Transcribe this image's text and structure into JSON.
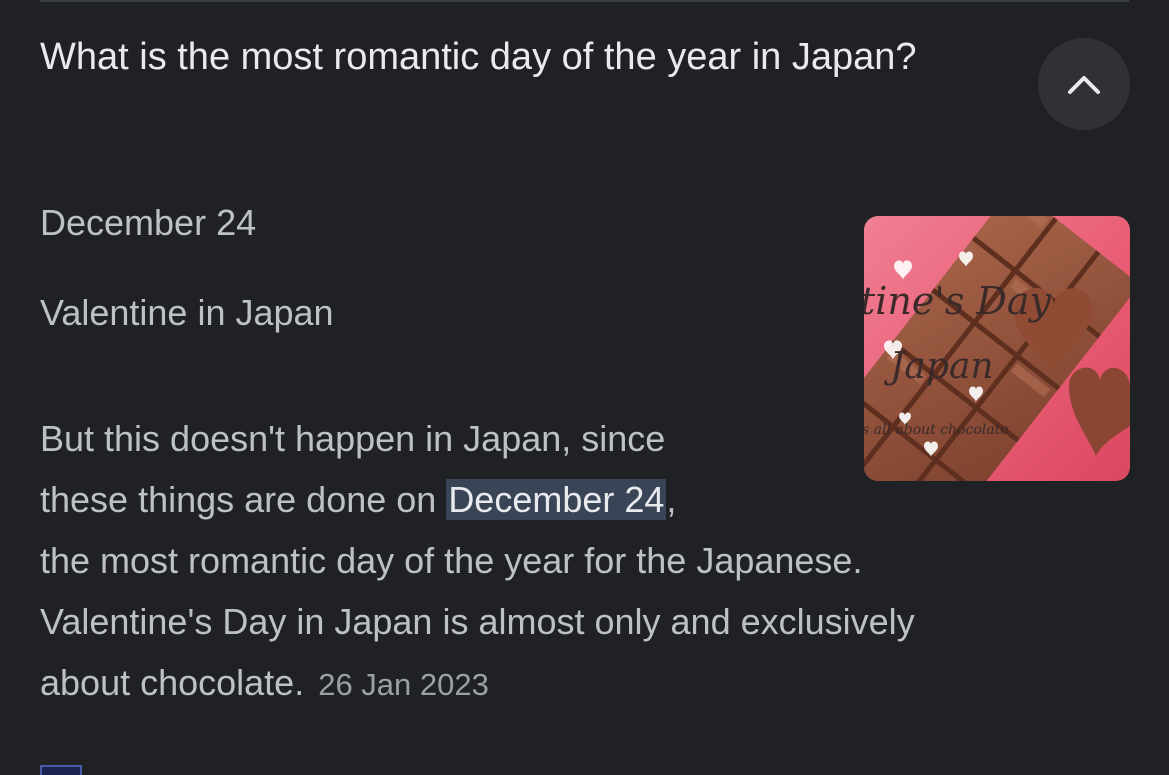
{
  "question": "What is the most romantic day of the year in Japan?",
  "collapse_icon": "chevron-up-icon",
  "answer": "December 24",
  "subtitle": "Valentine in Japan",
  "snippet": {
    "line1": "But this doesn't happen in Japan, since",
    "line2_before": "these things are done on ",
    "line2_highlight": "December 24",
    "line2_after": ",",
    "line3": "the most romantic day of the year for the Japanese.",
    "line4": "Valentine's Day in Japan is almost only and exclusively",
    "line5": "about chocolate.",
    "date": "26 Jan 2023"
  },
  "thumbnail": {
    "title_line1": "tine's Day",
    "title_line2": "Japan",
    "tagline": "s all about chocolate"
  },
  "colors": {
    "background": "#202124",
    "question_text": "#e8eaed",
    "body_text": "#bdc1c6",
    "highlight_bg": "#394457",
    "date_text": "#9aa0a6"
  }
}
